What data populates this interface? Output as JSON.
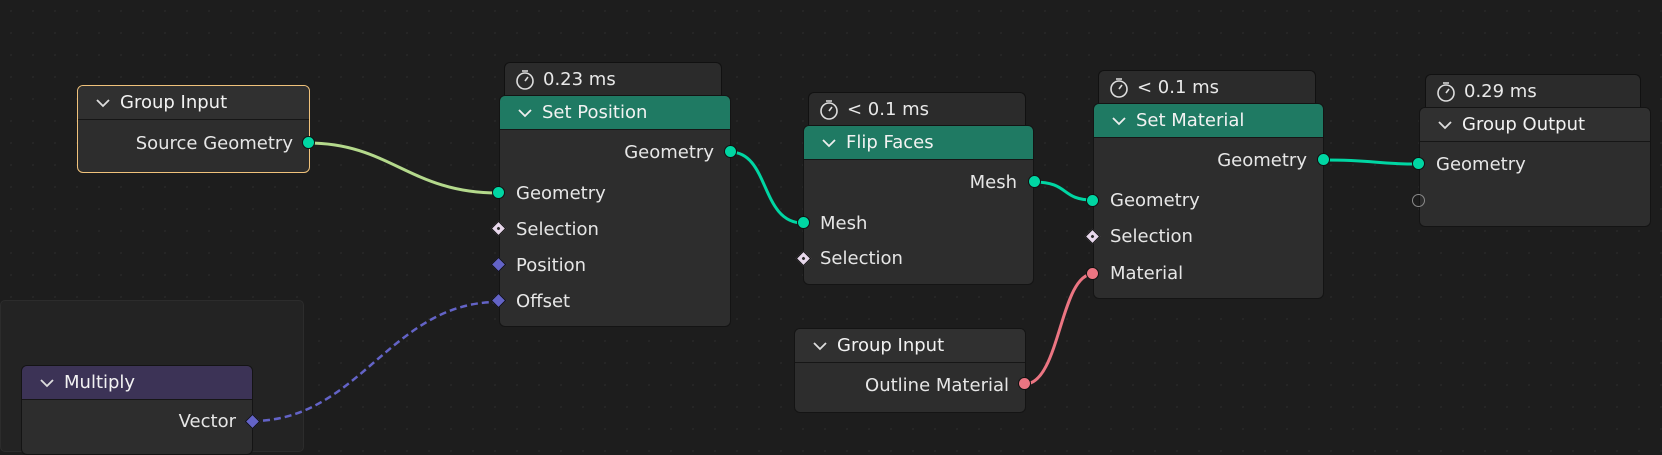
{
  "editor": "Geometry Nodes",
  "nodes": {
    "group_input_top": {
      "title": "Group Input",
      "outputs": [
        "Source Geometry"
      ]
    },
    "set_position": {
      "timing": "0.23 ms",
      "title": "Set Position",
      "outputs": [
        "Geometry"
      ],
      "inputs": [
        "Geometry",
        "Selection",
        "Position",
        "Offset"
      ]
    },
    "flip_faces": {
      "timing": "< 0.1 ms",
      "title": "Flip Faces",
      "outputs": [
        "Mesh"
      ],
      "inputs": [
        "Mesh",
        "Selection"
      ]
    },
    "set_material": {
      "timing": "< 0.1 ms",
      "title": "Set Material",
      "outputs": [
        "Geometry"
      ],
      "inputs": [
        "Geometry",
        "Selection",
        "Material"
      ]
    },
    "group_output": {
      "timing": "0.29 ms",
      "title": "Group Output",
      "inputs": [
        "Geometry"
      ]
    },
    "group_input_bottom": {
      "title": "Group Input",
      "outputs": [
        "Outline Material"
      ]
    },
    "multiply": {
      "title": "Multiply",
      "outputs": [
        "Vector"
      ]
    }
  },
  "socket_colors": {
    "geometry": "#00d6a3",
    "material": "#eb7582",
    "vector": "#6363c7",
    "field": "#e8d8ec"
  },
  "header_colors": {
    "geometry_node": "#1f7a63",
    "group_node": "#303030",
    "vector_math_node": "#3c3356",
    "selected_outline": "#f0c27b"
  },
  "links": [
    {
      "from": "Group Input.Source Geometry",
      "to": "Set Position.Geometry"
    },
    {
      "from": "Set Position.Geometry",
      "to": "Flip Faces.Mesh"
    },
    {
      "from": "Flip Faces.Mesh",
      "to": "Set Material.Geometry"
    },
    {
      "from": "Set Material.Geometry",
      "to": "Group Output.Geometry"
    },
    {
      "from": "Group Input.Outline Material",
      "to": "Set Material.Material"
    },
    {
      "from": "Multiply.Vector",
      "to": "Set Position.Offset"
    }
  ]
}
